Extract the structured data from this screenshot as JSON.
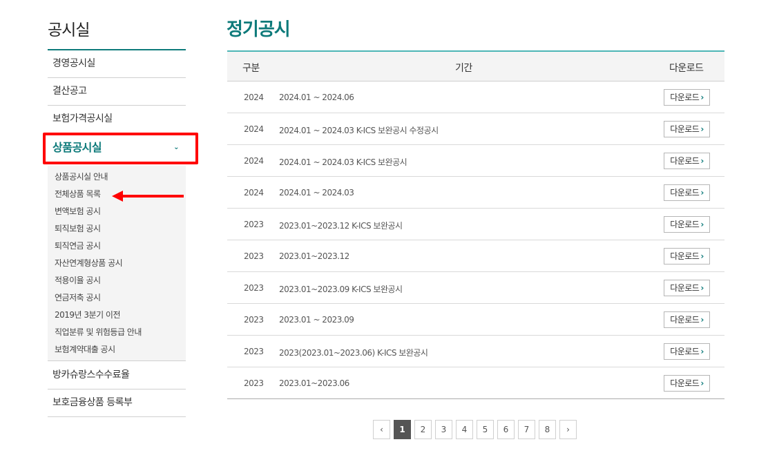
{
  "sidebar": {
    "title": "공시실",
    "items": [
      {
        "label": "경영공시실"
      },
      {
        "label": "결산공고"
      },
      {
        "label": "보험가격공시실"
      }
    ],
    "active": {
      "label": "상품공시실",
      "chevron": "⌄"
    },
    "subitems": [
      {
        "label": "상품공시실 안내"
      },
      {
        "label": "전체상품 목록"
      },
      {
        "label": "변액보험 공시"
      },
      {
        "label": "퇴직보험 공시"
      },
      {
        "label": "퇴직연금 공시"
      },
      {
        "label": "자산연계형상품 공시"
      },
      {
        "label": "적용이율 공시"
      },
      {
        "label": "연금저축 공시"
      },
      {
        "label": "2019년 3분기 이전"
      },
      {
        "label": "직업분류 및 위험등급 안내"
      },
      {
        "label": "보험계약대출 공시"
      }
    ],
    "bottom_items": [
      {
        "label": "방카슈랑스수수료율"
      },
      {
        "label": "보호금융상품 등록부"
      }
    ]
  },
  "main": {
    "title": "정기공시",
    "columns": {
      "category": "구분",
      "period": "기간",
      "download": "다운로드"
    },
    "download_label": "다운로드",
    "download_chevron": "›",
    "rows": [
      {
        "year": "2024",
        "period": "2024.01 ~ 2024.06"
      },
      {
        "year": "2024",
        "period": "2024.01 ~ 2024.03 K-ICS 보완공시 수정공시"
      },
      {
        "year": "2024",
        "period": "2024.01 ~ 2024.03 K-ICS 보완공시"
      },
      {
        "year": "2024",
        "period": "2024.01 ~ 2024.03"
      },
      {
        "year": "2023",
        "period": "2023.01~2023.12 K-ICS 보완공시"
      },
      {
        "year": "2023",
        "period": "2023.01~2023.12"
      },
      {
        "year": "2023",
        "period": "2023.01~2023.09 K-ICS 보완공시"
      },
      {
        "year": "2023",
        "period": "2023.01 ~ 2023.09"
      },
      {
        "year": "2023",
        "period": "2023(2023.01~2023.06) K-ICS 보완공시"
      },
      {
        "year": "2023",
        "period": "2023.01~2023.06"
      }
    ]
  },
  "pagination": {
    "prev": "‹",
    "next": "›",
    "pages": [
      "1",
      "2",
      "3",
      "4",
      "5",
      "6",
      "7",
      "8"
    ],
    "current": "1"
  },
  "colors": {
    "accent": "#0d7a7a",
    "highlight_box": "#ff0000",
    "annotation_arrow": "#ff0000",
    "pager_active": "#555555"
  }
}
